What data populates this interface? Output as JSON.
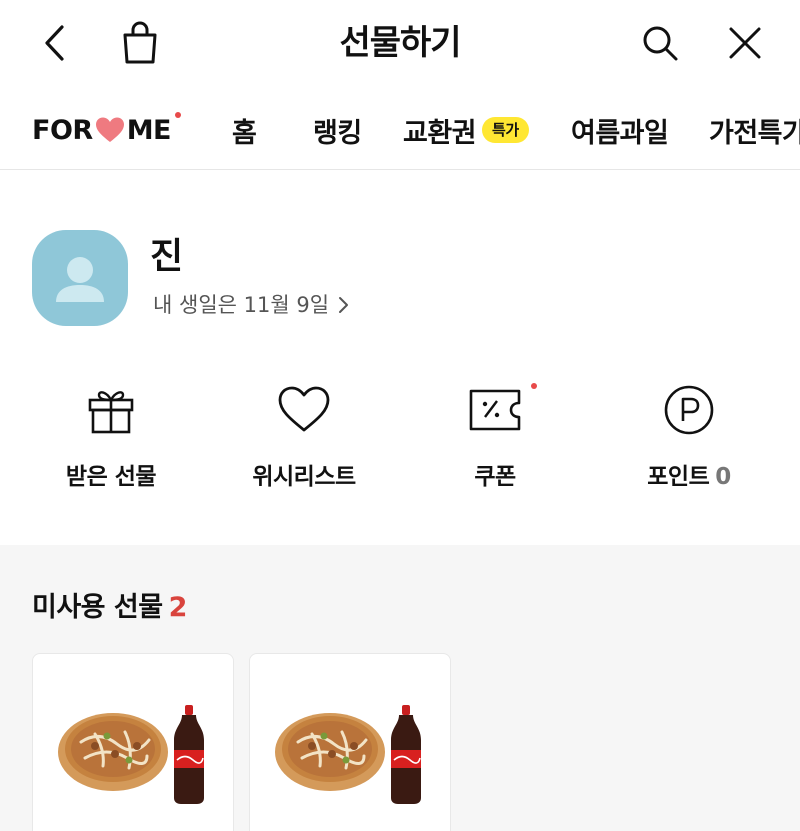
{
  "header": {
    "title": "선물하기",
    "icons": [
      "back-icon",
      "shopping-bag-icon",
      "search-icon",
      "close-icon"
    ]
  },
  "tabs": [
    {
      "label_left": "FOR",
      "label_right": "ME",
      "icon": "heart-icon",
      "dot": true
    },
    {
      "label": "홈"
    },
    {
      "label": "랭킹"
    },
    {
      "label": "교환권",
      "badge": "특가"
    },
    {
      "label": "여름과일"
    },
    {
      "label": "가전특가"
    }
  ],
  "profile": {
    "name": "진",
    "birthday": "내 생일은 11월 9일",
    "avatar_color": "#8fc7d8"
  },
  "menu": [
    {
      "label": "받은 선물",
      "icon": "gift-icon"
    },
    {
      "label": "위시리스트",
      "icon": "heart-outline-icon"
    },
    {
      "label": "쿠폰",
      "icon": "coupon-icon",
      "dot": true
    },
    {
      "label": "포인트",
      "count": "0",
      "icon": "point-icon"
    }
  ],
  "unused_gifts": {
    "title": "미사용 선물",
    "count": "2",
    "items": [
      {
        "image": "pizza-and-cola-image"
      },
      {
        "image": "pizza-and-cola-image"
      }
    ]
  },
  "colors": {
    "accent_red": "#d9443d",
    "badge_yellow": "#ffe733",
    "dot_red": "#e84a4a",
    "section_bg": "#f6f6f6"
  }
}
